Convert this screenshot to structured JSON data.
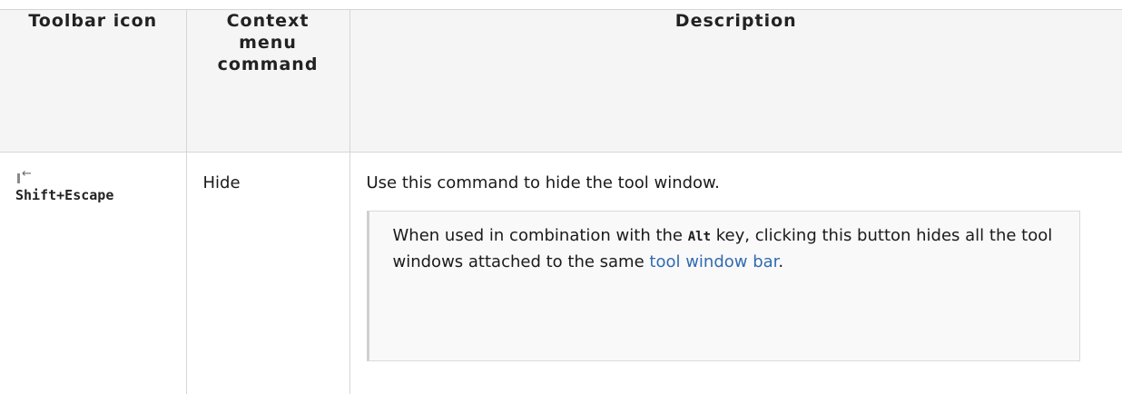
{
  "table": {
    "headers": {
      "toolbar_icon": "Toolbar icon",
      "context_menu_command": "Context menu command",
      "description": "Description"
    },
    "rows": [
      {
        "icon": "hide-tool-window-icon",
        "shortcut": "Shift+Escape",
        "command": "Hide",
        "description": "Use this command to hide the tool window.",
        "note": {
          "text_before_code": "When used in combination with the ",
          "code": "Alt",
          "text_after_code": " key, clicking this button hides all the tool windows attached to the same ",
          "link_text": "tool window bar",
          "text_end": "."
        }
      }
    ]
  },
  "colors": {
    "link": "#316bb0",
    "header_bg": "#f5f5f5",
    "note_bg": "#f9f9f9",
    "border": "#d6d6d6"
  }
}
